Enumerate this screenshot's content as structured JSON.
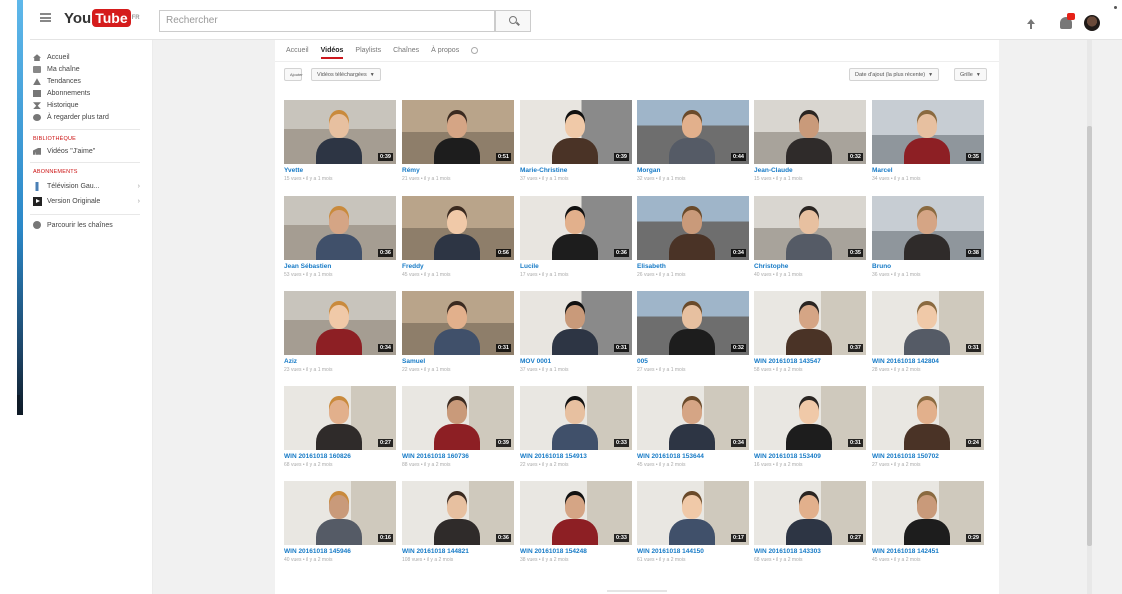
{
  "masthead": {
    "logo_you": "You",
    "logo_tube": "Tube",
    "logo_region": "FR",
    "search_placeholder": "Rechercher"
  },
  "guide": {
    "main": [
      {
        "label": "Accueil",
        "icon": "home-icon"
      },
      {
        "label": "Ma chaîne",
        "icon": "channel-icon"
      },
      {
        "label": "Tendances",
        "icon": "trending-icon"
      },
      {
        "label": "Abonnements",
        "icon": "subscriptions-icon"
      },
      {
        "label": "Historique",
        "icon": "history-icon"
      },
      {
        "label": "À regarder plus tard",
        "icon": "watch-later-icon"
      }
    ],
    "library_heading": "BIBLIOTHÈQUE",
    "library": [
      {
        "label": "Vidéos \"J'aime\"",
        "icon": "liked-videos-icon"
      }
    ],
    "subscriptions_heading": "ABONNEMENTS",
    "subscriptions": [
      {
        "label": "Télévision Gau...",
        "icon": "tv-channel-icon"
      },
      {
        "label": "Version Originale",
        "icon": "vo-channel-icon"
      }
    ],
    "browse_channels": "Parcourir les chaînes"
  },
  "channel": {
    "tabs": [
      "Accueil",
      "Vidéos",
      "Playlists",
      "Chaînes",
      "À propos"
    ],
    "active_tab": "Vidéos",
    "toolbar": {
      "all_button": "Ajouter",
      "filter_button": "Vidéos téléchargées",
      "sort_button": "Date d'ajout (la plus récente)",
      "view_button": "Grille"
    }
  },
  "videos": [
    {
      "title": "Yvette",
      "meta": "15 vues • il y a 1 mois",
      "duration": "0:39"
    },
    {
      "title": "Rémy",
      "meta": "21 vues • il y a 1 mois",
      "duration": "0:51"
    },
    {
      "title": "Marie-Christine",
      "meta": "37 vues • il y a 1 mois",
      "duration": "0:39"
    },
    {
      "title": "Morgan",
      "meta": "32 vues • il y a 1 mois",
      "duration": "0:44"
    },
    {
      "title": "Jean-Claude",
      "meta": "15 vues • il y a 1 mois",
      "duration": "0:32"
    },
    {
      "title": "Marcel",
      "meta": "34 vues • il y a 1 mois",
      "duration": "0:35"
    },
    {
      "title": "Jean Sébastien",
      "meta": "53 vues • il y a 1 mois",
      "duration": "0:36"
    },
    {
      "title": "Freddy",
      "meta": "45 vues • il y a 1 mois",
      "duration": "0:56"
    },
    {
      "title": "Lucile",
      "meta": "17 vues • il y a 1 mois",
      "duration": "0:36"
    },
    {
      "title": "Elisabeth",
      "meta": "26 vues • il y a 1 mois",
      "duration": "0:34"
    },
    {
      "title": "Christophe",
      "meta": "40 vues • il y a 1 mois",
      "duration": "0:35"
    },
    {
      "title": "Bruno",
      "meta": "36 vues • il y a 1 mois",
      "duration": "0:38"
    },
    {
      "title": "Aziz",
      "meta": "23 vues • il y a 1 mois",
      "duration": "0:34"
    },
    {
      "title": "Samuel",
      "meta": "22 vues • il y a 1 mois",
      "duration": "0:31"
    },
    {
      "title": "MOV 0001",
      "meta": "37 vues • il y a 1 mois",
      "duration": "0:31"
    },
    {
      "title": "005",
      "meta": "27 vues • il y a 1 mois",
      "duration": "0:32"
    },
    {
      "title": "WIN 20161018 143547",
      "meta": "58 vues • il y a 2 mois",
      "duration": "0:37"
    },
    {
      "title": "WIN 20161018 142804",
      "meta": "28 vues • il y a 2 mois",
      "duration": "0:31"
    },
    {
      "title": "WIN 20161018 160826",
      "meta": "68 vues • il y a 2 mois",
      "duration": "0:27"
    },
    {
      "title": "WIN 20161018 160736",
      "meta": "88 vues • il y a 2 mois",
      "duration": "0:39"
    },
    {
      "title": "WIN 20161018 154913",
      "meta": "22 vues • il y a 2 mois",
      "duration": "0:33"
    },
    {
      "title": "WIN 20161018 153644",
      "meta": "45 vues • il y a 2 mois",
      "duration": "0:34"
    },
    {
      "title": "WIN 20161018 153409",
      "meta": "16 vues • il y a 2 mois",
      "duration": "0:31"
    },
    {
      "title": "WIN 20161018 150702",
      "meta": "27 vues • il y a 2 mois",
      "duration": "0:24"
    },
    {
      "title": "WIN 20161018 145946",
      "meta": "40 vues • il y a 2 mois",
      "duration": "0:16"
    },
    {
      "title": "WIN 20161018 144821",
      "meta": "108 vues • il y a 2 mois",
      "duration": "0:36"
    },
    {
      "title": "WIN 20161018 154248",
      "meta": "38 vues • il y a 2 mois",
      "duration": "0:33"
    },
    {
      "title": "WIN 20161018 144150",
      "meta": "61 vues • il y a 2 mois",
      "duration": "0:17"
    },
    {
      "title": "WIN 20161018 143303",
      "meta": "68 vues • il y a 2 mois",
      "duration": "0:27"
    },
    {
      "title": "WIN 20161018 142451",
      "meta": "45 vues • il y a 2 mois",
      "duration": "0:29"
    }
  ]
}
